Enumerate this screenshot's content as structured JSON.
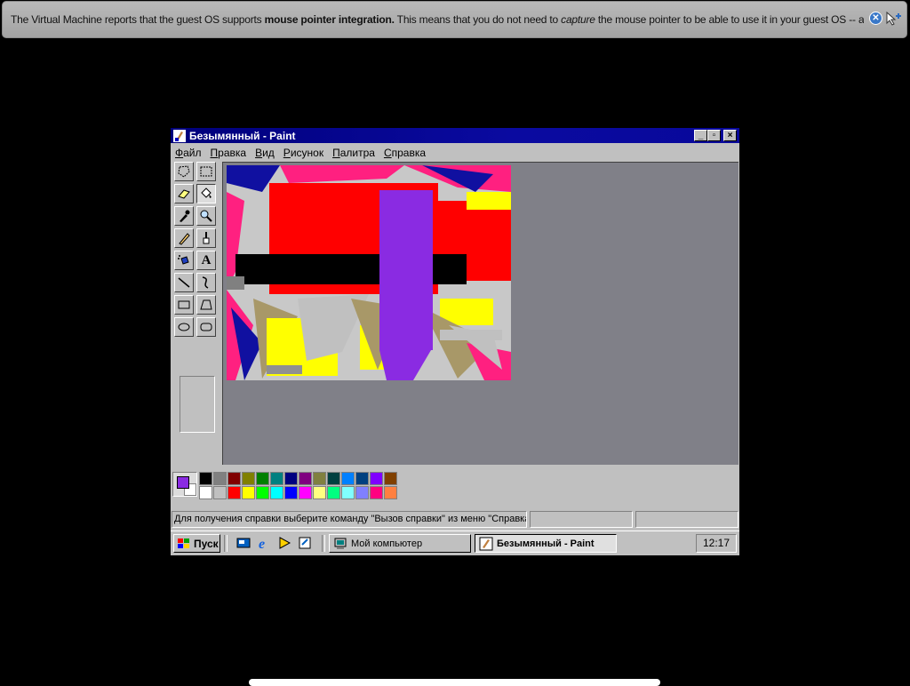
{
  "notification": {
    "text_pre": "The Virtual Machine reports that the guest OS supports ",
    "text_bold": "mouse pointer integration.",
    "text_mid": " This means that you do not need to ",
    "text_italic": "capture",
    "text_post": " the mouse pointer to be able to use it in your guest OS -- all mouse",
    "close_icon": "close-icon",
    "mouse_icon": "mouse-integration-icon"
  },
  "window": {
    "title": "Безымянный - Paint",
    "minimize": "_",
    "maximize": "▫",
    "close": "×"
  },
  "menu": {
    "items": [
      {
        "underline": "Ф",
        "rest": "айл"
      },
      {
        "underline": "П",
        "rest": "равка"
      },
      {
        "underline": "В",
        "rest": "ид"
      },
      {
        "underline": "Р",
        "rest": "исунок"
      },
      {
        "underline": "П",
        "rest": "алитра"
      },
      {
        "underline": "С",
        "rest": "правка"
      }
    ]
  },
  "tools": [
    "free-form-select",
    "rect-select",
    "eraser",
    "fill",
    "color-picker",
    "magnifier",
    "pencil",
    "brush",
    "airbrush",
    "text",
    "line",
    "curve",
    "rectangle",
    "polygon",
    "ellipse",
    "rounded-rectangle"
  ],
  "tool_text_label": "A",
  "palette": {
    "foreground": "#8a2be2",
    "background": "#ffffff",
    "row1": [
      "#000000",
      "#808080",
      "#800000",
      "#808000",
      "#008000",
      "#008080",
      "#000080",
      "#800080",
      "#808040",
      "#004040",
      "#0080ff",
      "#004080",
      "#8000ff",
      "#804000"
    ],
    "row2": [
      "#ffffff",
      "#c0c0c0",
      "#ff0000",
      "#ffff00",
      "#00ff00",
      "#00ffff",
      "#0000ff",
      "#ff00ff",
      "#ffff80",
      "#00ff80",
      "#80ffff",
      "#8080ff",
      "#ff0080",
      "#ff8040"
    ]
  },
  "status": {
    "help": "Для получения справки выберите команду \"Вызов справки\" из меню \"Справка\".",
    "pane2": "",
    "pane3": ""
  },
  "taskbar": {
    "start": "Пуск",
    "tasks": [
      {
        "label": "Мой компьютер",
        "active": false
      },
      {
        "label": "Безымянный - Paint",
        "active": true
      }
    ],
    "clock": "12:17"
  }
}
